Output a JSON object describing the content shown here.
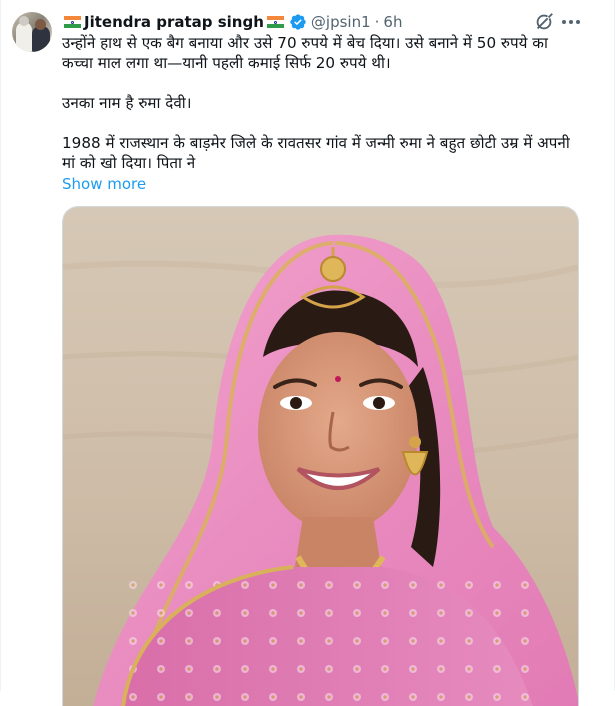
{
  "tweet": {
    "author": {
      "display_name": "Jitendra pratap singh",
      "handle": "@jpsin1",
      "verified": true,
      "name_emoji": "india-flag"
    },
    "separator": "·",
    "time": "6h",
    "text": {
      "p1": "उन्होंने हाथ से एक बैग बनाया और उसे 70 रुपये में बेच दिया। उसे बनाने में 50 रुपये का कच्चा माल लगा था—यानी पहली कमाई सिर्फ 20 रुपये थी।",
      "p2": "उनका नाम है रुमा देवी।",
      "p3": "1988 में राजस्थान के बाड़मेर जिले के रावतसर गांव में जन्मी रुमा ने बहुत छोटी उम्र में अपनी मां को खो दिया। पिता ने"
    },
    "show_more": "Show more",
    "media": {
      "kind": "photo",
      "subject": "woman-in-pink-rajasthani-dupatta"
    },
    "icons": [
      "grok-icon",
      "more-icon",
      "verified-badge-icon"
    ]
  },
  "colors": {
    "text": "#0f1419",
    "secondary": "#536471",
    "link": "#1d9bf0",
    "verified": "#1d9bf0",
    "border": "#cfd9de"
  }
}
